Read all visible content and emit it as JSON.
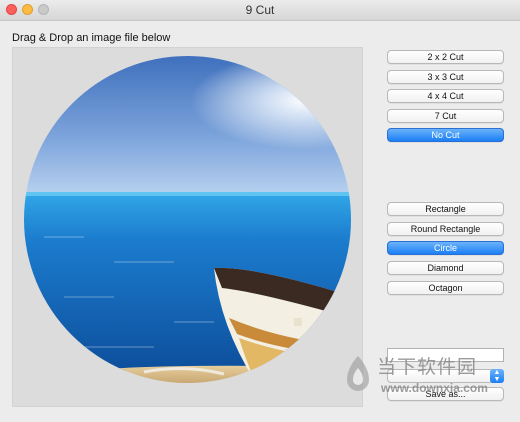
{
  "window": {
    "title": "9 Cut"
  },
  "prompt": "Drag & Drop an image file below",
  "cut_buttons": [
    {
      "label": "2 x 2 Cut",
      "active": false
    },
    {
      "label": "3 x 3 Cut",
      "active": false
    },
    {
      "label": "4 x 4 Cut",
      "active": false
    },
    {
      "label": "7 Cut",
      "active": false
    },
    {
      "label": "No Cut",
      "active": true
    }
  ],
  "shape_buttons": [
    {
      "label": "Rectangle",
      "active": false
    },
    {
      "label": "Round Rectangle",
      "active": false
    },
    {
      "label": "Circle",
      "active": true
    },
    {
      "label": "Diamond",
      "active": false
    },
    {
      "label": "Octagon",
      "active": false
    }
  ],
  "output": {
    "filename_value": "",
    "format_value": ""
  },
  "save_label": "Save as...",
  "watermark": {
    "text": "当下软件园",
    "url": "www.downxia.com"
  },
  "colors": {
    "accent": "#1a7ff5",
    "sky_top": "#5a86c8",
    "sea": "#1f6fc0",
    "sand": "#e0c79a"
  }
}
